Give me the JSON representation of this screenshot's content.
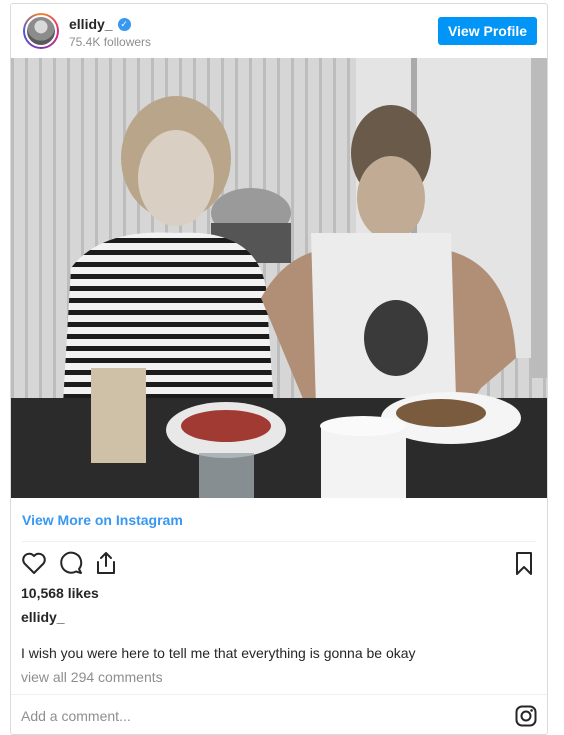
{
  "header": {
    "username": "ellidy_",
    "followers": "75.4K followers",
    "view_profile": "View Profile"
  },
  "post": {
    "view_more": "View More on Instagram",
    "likes": "10,568 likes",
    "caption_username": "ellidy_",
    "caption": "I wish you were here to tell me that everything is gonna be okay",
    "view_comments": "view all 294 comments",
    "comment_placeholder": "Add a comment...",
    "photo_alt": ""
  },
  "icons": {
    "like": "heart-icon",
    "comment": "comment-icon",
    "share": "share-icon",
    "save": "bookmark-icon",
    "instagram": "instagram-icon",
    "verified": "verified-badge-icon"
  },
  "colors": {
    "accent": "#0095f6",
    "link": "#3897f0",
    "muted": "#8e8e8e"
  }
}
